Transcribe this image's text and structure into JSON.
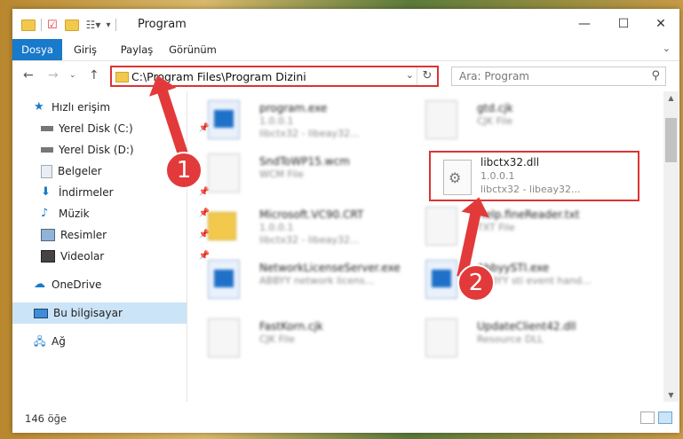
{
  "window": {
    "title": "Program"
  },
  "ribbon": {
    "tabs": [
      "Dosya",
      "Giriş",
      "Paylaş",
      "Görünüm"
    ]
  },
  "address": {
    "path": "C:\\Program Files\\Program Dizini"
  },
  "search": {
    "placeholder": "Ara: Program"
  },
  "sidebar": {
    "items": [
      {
        "label": "Hızlı erişim",
        "icon": "star-icon"
      },
      {
        "label": "Yerel Disk (C:)",
        "icon": "drive-icon",
        "pinned": true
      },
      {
        "label": "Yerel Disk (D:)",
        "icon": "drive-icon"
      },
      {
        "label": "Belgeler",
        "icon": "documents-icon"
      },
      {
        "label": "İndirmeler",
        "icon": "download-icon",
        "pinned": true
      },
      {
        "label": "Müzik",
        "icon": "music-icon",
        "pinned": true
      },
      {
        "label": "Resimler",
        "icon": "pictures-icon",
        "pinned": true
      },
      {
        "label": "Videolar",
        "icon": "videos-icon",
        "pinned": true
      },
      {
        "label": "OneDrive",
        "icon": "cloud-icon"
      },
      {
        "label": "Bu bilgisayar",
        "icon": "computer-icon",
        "selected": true
      },
      {
        "label": "Ağ",
        "icon": "network-icon"
      }
    ]
  },
  "files": [
    {
      "name": "program.exe",
      "line2": "1.0.0.1",
      "line3": "libctx32 - libeay32...",
      "kind": "app"
    },
    {
      "name": "gtd.cjk",
      "line2": "CJK File",
      "line3": "",
      "kind": "file"
    },
    {
      "name": "SndToWP15.wcm",
      "line2": "WCM File",
      "line3": "",
      "kind": "file"
    },
    {
      "name": "libctx32.dll",
      "line2": "1.0.0.1",
      "line3": "libctx32 - libeay32...",
      "kind": "dll"
    },
    {
      "name": "Microsoft.VC90.CRT",
      "line2": "1.0.0.1",
      "line3": "libctx32 - libeay32...",
      "kind": "folder"
    },
    {
      "name": "Help.fineReader.txt",
      "line2": "TXT File",
      "line3": "",
      "kind": "file"
    },
    {
      "name": "NetworkLicenseServer.exe",
      "line2": "ABBYY network licens...",
      "line3": "",
      "kind": "app"
    },
    {
      "name": "AbbyySTI.exe",
      "line2": "ABBYY sti event hand...",
      "line3": "",
      "kind": "app"
    },
    {
      "name": "FastKorn.cjk",
      "line2": "CJK File",
      "line3": "",
      "kind": "file"
    },
    {
      "name": "UpdateClient42.dll",
      "line2": "Resource DLL",
      "line3": "",
      "kind": "file"
    }
  ],
  "status": {
    "count": "146 öğe"
  },
  "annotations": [
    {
      "label": "1"
    },
    {
      "label": "2"
    }
  ],
  "colors": {
    "accent": "#1979ca",
    "highlight": "#dd3333"
  }
}
